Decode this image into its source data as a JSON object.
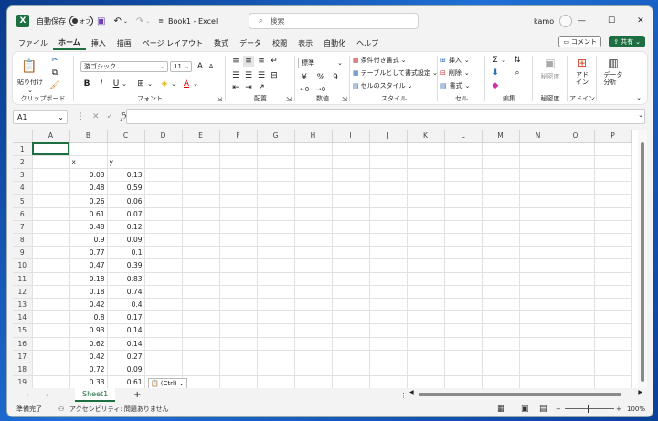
{
  "titlebar": {
    "autosave_label": "自動保存",
    "autosave_state": "オフ",
    "book_title": "Book1  -  Excel",
    "search_placeholder": "検索",
    "user_name": "kamo",
    "minimize": "—",
    "maximize": "☐",
    "close": "✕"
  },
  "menu": {
    "items": [
      "ファイル",
      "ホーム",
      "挿入",
      "描画",
      "ページ レイアウト",
      "数式",
      "データ",
      "校閲",
      "表示",
      "自動化",
      "ヘルプ"
    ],
    "active_index": 1,
    "comment_label": "コメント",
    "share_label": "共有"
  },
  "ribbon": {
    "clipboard": {
      "paste_label": "貼り付け",
      "group": "クリップボード"
    },
    "font": {
      "font_name": "游ゴシック",
      "font_size": "11",
      "bold": "B",
      "italic": "I",
      "underline": "U",
      "group": "フォント",
      "grow": "A",
      "shrink": "A"
    },
    "alignment": {
      "group": "配置"
    },
    "number": {
      "format": "標準",
      "percent": "%",
      "comma": "9",
      "group": "数値"
    },
    "styles": {
      "conditional": "条件付き書式",
      "table": "テーブルとして書式設定",
      "cell_styles": "セルのスタイル",
      "group": "スタイル"
    },
    "cells": {
      "insert": "挿入",
      "delete": "削除",
      "format": "書式",
      "group": "セル"
    },
    "editing": {
      "sum": "Σ",
      "group": "編集"
    },
    "sensitivity": {
      "label": "秘密度",
      "group": "秘密度"
    },
    "addins": {
      "label": "アド\nイン",
      "group": "アドイン"
    },
    "analysis": {
      "label": "データ\n分析"
    }
  },
  "formula_bar": {
    "name_box": "A1",
    "fx": "fx",
    "value": ""
  },
  "grid": {
    "columns": [
      "A",
      "B",
      "C",
      "D",
      "E",
      "F",
      "G",
      "H",
      "I",
      "J",
      "K",
      "L",
      "M",
      "N",
      "O",
      "P"
    ],
    "rows": [
      {
        "n": "1",
        "b": "",
        "c": ""
      },
      {
        "n": "2",
        "b": "x",
        "c": "y"
      },
      {
        "n": "3",
        "b": "0.03",
        "c": "0.13"
      },
      {
        "n": "4",
        "b": "0.48",
        "c": "0.59"
      },
      {
        "n": "5",
        "b": "0.26",
        "c": "0.06"
      },
      {
        "n": "6",
        "b": "0.61",
        "c": "0.07"
      },
      {
        "n": "7",
        "b": "0.48",
        "c": "0.12"
      },
      {
        "n": "8",
        "b": "0.9",
        "c": "0.09"
      },
      {
        "n": "9",
        "b": "0.77",
        "c": "0.1"
      },
      {
        "n": "10",
        "b": "0.47",
        "c": "0.39"
      },
      {
        "n": "11",
        "b": "0.18",
        "c": "0.83"
      },
      {
        "n": "12",
        "b": "0.18",
        "c": "0.74"
      },
      {
        "n": "13",
        "b": "0.42",
        "c": "0.4"
      },
      {
        "n": "14",
        "b": "0.8",
        "c": "0.17"
      },
      {
        "n": "15",
        "b": "0.93",
        "c": "0.14"
      },
      {
        "n": "16",
        "b": "0.62",
        "c": "0.14"
      },
      {
        "n": "17",
        "b": "0.42",
        "c": "0.27"
      },
      {
        "n": "18",
        "b": "0.72",
        "c": "0.09"
      },
      {
        "n": "19",
        "b": "0.33",
        "c": "0.61"
      }
    ],
    "paste_options": "(Ctrl)"
  },
  "sheets": {
    "active": "Sheet1",
    "add": "+"
  },
  "status": {
    "ready": "準備完了",
    "accessibility": "アクセシビリティ: 問題ありません",
    "zoom": "100%"
  },
  "colors": {
    "accent": "#1d6f42"
  }
}
